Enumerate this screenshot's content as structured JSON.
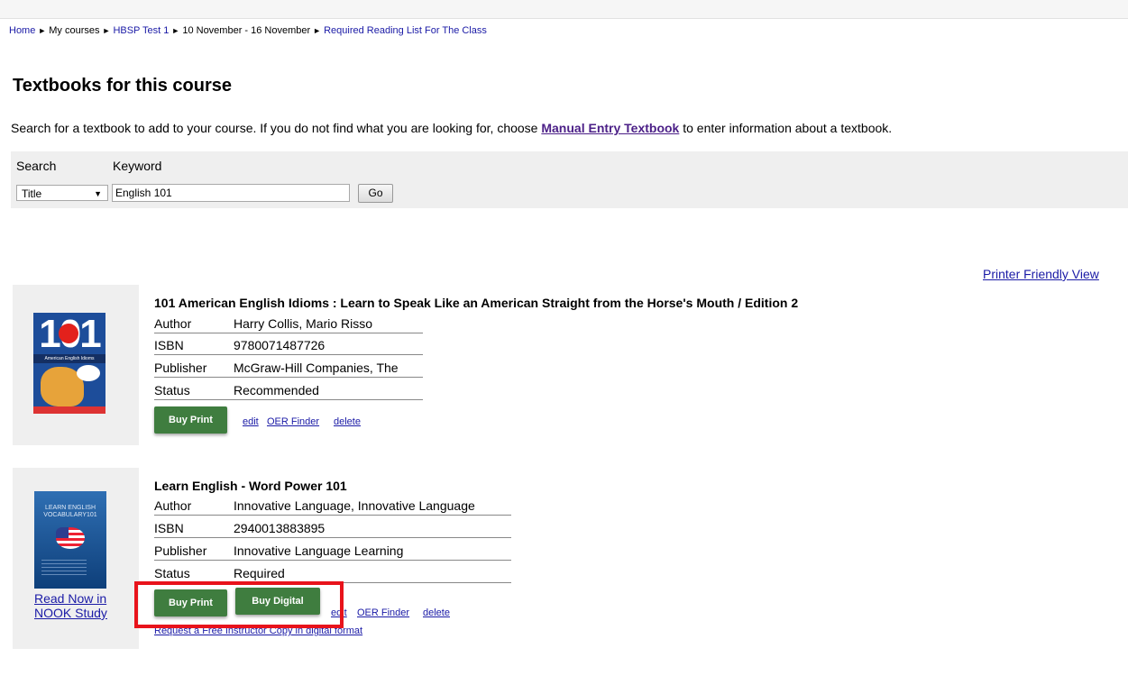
{
  "breadcrumb": {
    "items": [
      "Home",
      "My courses",
      "HBSP Test 1",
      "10 November - 16 November",
      "Required Reading List For The Class"
    ],
    "separator": "►"
  },
  "page_title": "Textbooks for this course",
  "intro": {
    "before": "Search for a textbook to add to your course. If you do not find what you are looking for, choose ",
    "link": "Manual Entry Textbook",
    "after": " to enter information about a textbook."
  },
  "search": {
    "search_label": "Search",
    "keyword_label": "Keyword",
    "select_value": "Title",
    "keyword_value": "English 101",
    "go_label": "Go"
  },
  "printer_link": "Printer Friendly View",
  "field_labels": {
    "author": "Author",
    "isbn": "ISBN",
    "publisher": "Publisher",
    "status": "Status"
  },
  "books": [
    {
      "title": "101 American English Idioms : Learn to Speak Like an American Straight from the Horse's Mouth / Edition 2",
      "author": "Harry Collis, Mario Risso",
      "isbn": "9780071487726",
      "publisher": "McGraw-Hill Companies, The",
      "status": "Recommended",
      "buy_print": "Buy Print",
      "edit": "edit",
      "oer": "OER Finder",
      "delete": "delete",
      "cover_text": {
        "number": "101",
        "band": "American English Idioms"
      }
    },
    {
      "title": "Learn English - Word Power 101",
      "author": "Innovative Language, Innovative Language",
      "isbn": "2940013883895",
      "publisher": "Innovative Language Learning",
      "status": "Required",
      "buy_print": "Buy Print",
      "buy_digital": "Buy Digital",
      "edit": "edit",
      "oer": "OER Finder",
      "delete": "delete",
      "read_now": "Read Now in NOOK Study",
      "request_copy": "Request a Free Instructor Copy in digital format",
      "cover_text": {
        "title": "LEARN ENGLISH VOCABULARY101"
      }
    }
  ],
  "colors": {
    "button_green": "#3f7d3f",
    "highlight_red": "#e8131b",
    "link_blue": "#1a1aa6",
    "panel_gray": "#efefef"
  }
}
